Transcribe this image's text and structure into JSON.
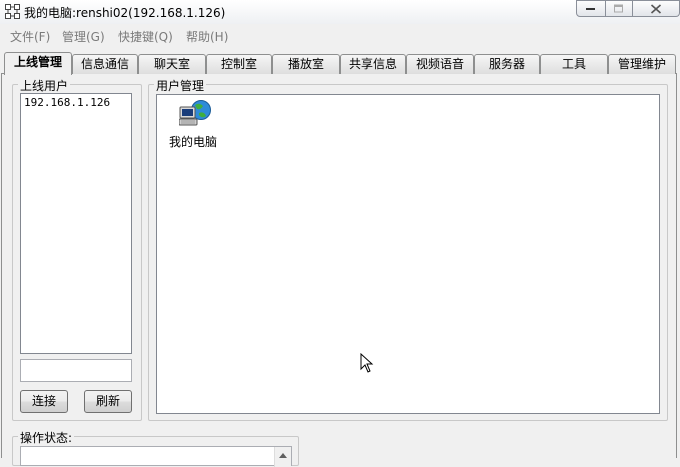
{
  "window": {
    "title": "我的电脑:renshi02(192.168.1.126)"
  },
  "menu": [
    {
      "label": "文件(F)"
    },
    {
      "label": "管理(G)"
    },
    {
      "label": "快捷键(Q)"
    },
    {
      "label": "帮助(H)"
    }
  ],
  "tabs": [
    {
      "label": "上线管理",
      "active": true
    },
    {
      "label": "信息通信"
    },
    {
      "label": "聊天室"
    },
    {
      "label": "控制室"
    },
    {
      "label": "播放室"
    },
    {
      "label": "共享信息"
    },
    {
      "label": "视频语音"
    },
    {
      "label": "服务器"
    },
    {
      "label": "工具"
    },
    {
      "label": "管理维护"
    }
  ],
  "online_users": {
    "group_label": "上线用户",
    "items": [
      "192.168.1.126"
    ],
    "input_value": "",
    "connect_label": "连接",
    "refresh_label": "刷新"
  },
  "user_management": {
    "group_label": "用户管理",
    "icon": "my-computer-icon",
    "icon_label": "我的电脑"
  },
  "status": {
    "group_label": "操作状态:"
  },
  "colors": {
    "window_bg": "#f0f0f0",
    "menu_text_disabled": "#7a7a7a",
    "border": "#8e8f8f"
  }
}
